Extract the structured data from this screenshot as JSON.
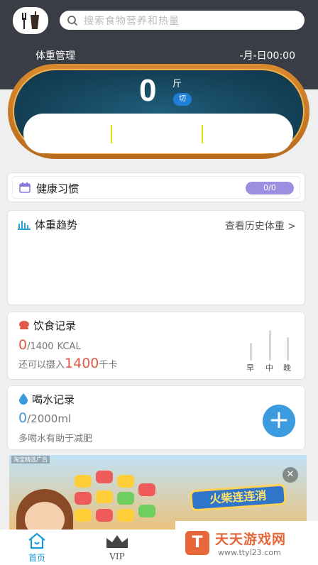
{
  "header": {
    "search_placeholder": "搜索食物营养和热量",
    "title": "体重管理",
    "datetime": "-月-日00:00"
  },
  "weight": {
    "value": "0",
    "unit": "斤",
    "unit_toggle": "切"
  },
  "habit": {
    "title": "健康习惯",
    "count": "0/0",
    "accent": "#9b8fe0"
  },
  "trend": {
    "title": "体重趋势",
    "link": "查看历史体重 >"
  },
  "diet": {
    "title": "饮食记录",
    "consumed": "0",
    "target": "/1400",
    "unit": "KCAL",
    "remaining_prefix": "还可以摄入",
    "remaining": "1400",
    "remaining_unit": "千卡",
    "meals": [
      "早",
      "中",
      "晚"
    ]
  },
  "water": {
    "title": "喝水记录",
    "consumed": "0",
    "target": "/2000ml",
    "tip": "多喝水有助于减肥",
    "add_symbol": "+",
    "accent": "#3b9bde"
  },
  "ad": {
    "tag": "淘宝精选广告",
    "close_symbol": "✕",
    "banner": "火柴连连消"
  },
  "nav": {
    "home": "首页",
    "vip": "VIP",
    "active_color": "#1a9ad8"
  },
  "watermark": {
    "logo": "T",
    "title": "天天游戏网",
    "url": "www.ttyl23.com"
  }
}
